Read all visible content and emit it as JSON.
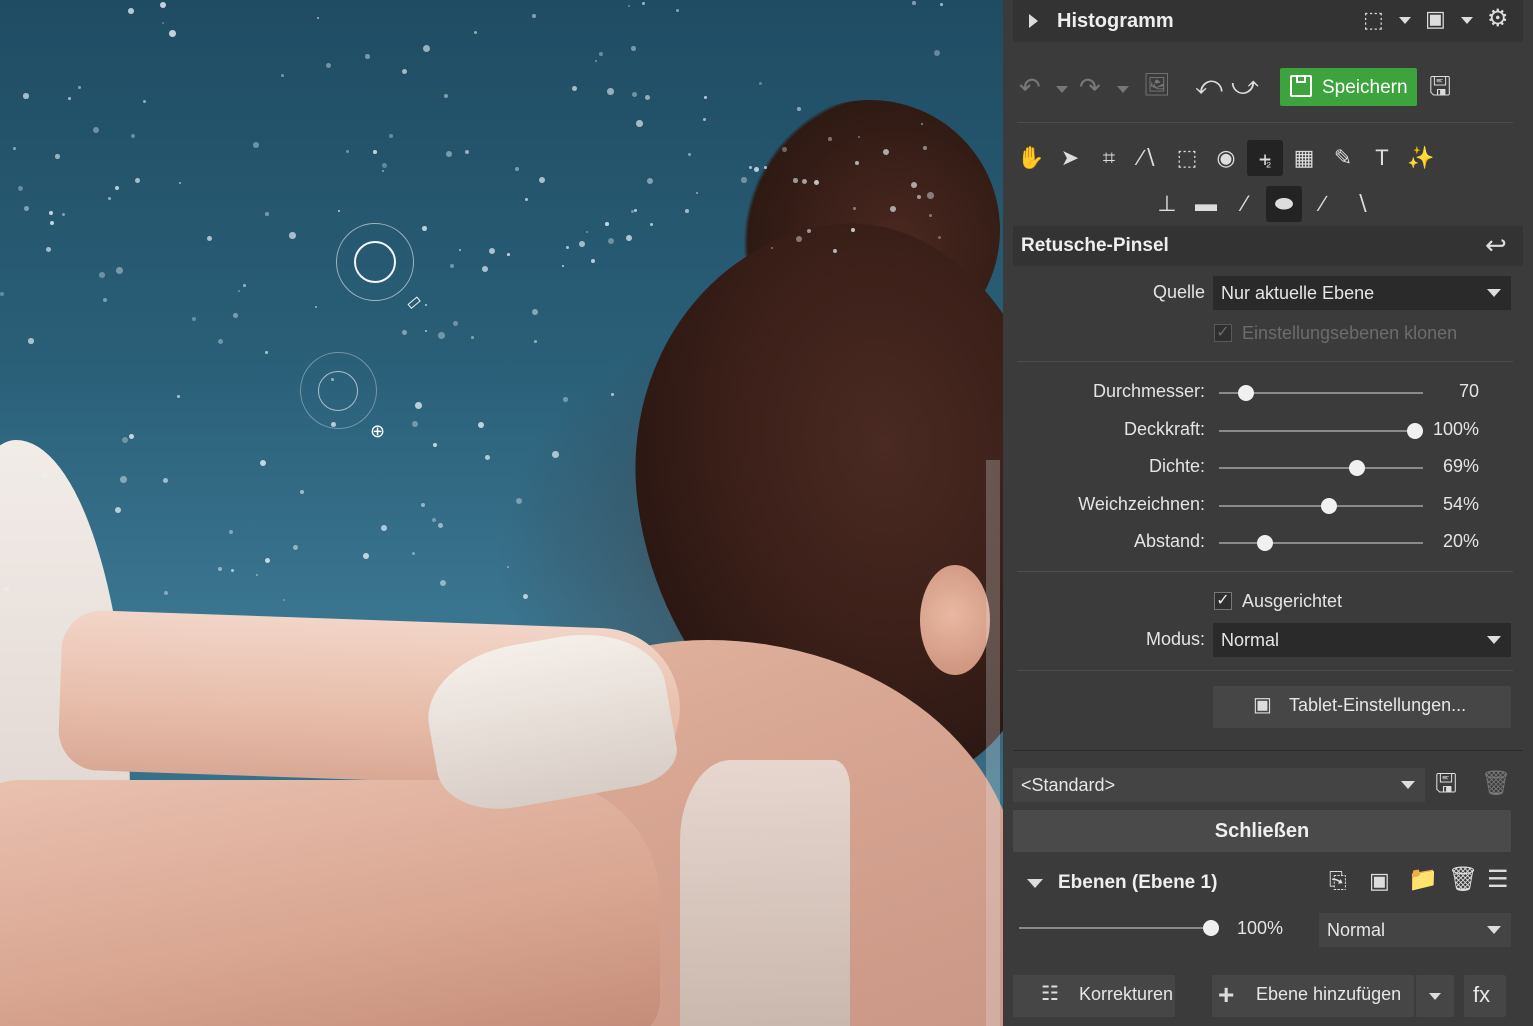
{
  "header": {
    "title": "Histogramm"
  },
  "toolbar": {
    "save_label": "Speichern"
  },
  "tool_section": {
    "title": "Retusche-Pinsel"
  },
  "source": {
    "label": "Quelle",
    "value": "Nur aktuelle Ebene",
    "clone_adjustments_label": "Einstellungsebenen klonen",
    "clone_adjustments_checked": true,
    "clone_adjustments_enabled": false
  },
  "sliders": [
    {
      "label": "Durchmesser:",
      "value": "70",
      "fraction": 0.1
    },
    {
      "label": "Deckkraft:",
      "value": "100%",
      "fraction": 1.0
    },
    {
      "label": "Dichte:",
      "value": "69%",
      "fraction": 0.69
    },
    {
      "label": "Weichzeichnen:",
      "value": "54%",
      "fraction": 0.54
    },
    {
      "label": "Abstand:",
      "value": "20%",
      "fraction": 0.2
    }
  ],
  "aligned": {
    "label": "Ausgerichtet",
    "checked": true
  },
  "mode": {
    "label": "Modus:",
    "value": "Normal"
  },
  "tablet_button": {
    "label": "Tablet-Einstellungen..."
  },
  "preset": {
    "value": "<Standard>"
  },
  "close_button": {
    "label": "Schließen"
  },
  "layers": {
    "title": "Ebenen (Ebene 1)",
    "opacity": "100%",
    "opacity_fraction": 1.0,
    "blend_mode": "Normal"
  },
  "bottom": {
    "corrections_label": "Korrekturen",
    "add_layer_label": "Ebene hinzufügen",
    "fx_label": "fx"
  },
  "icons": [
    "expand-triangle-icon",
    "crop-frame-icon",
    "mask-icon",
    "settings-gear-icon",
    "undo-icon",
    "redo-icon",
    "image-icon",
    "rotate-left-icon",
    "rotate-right-icon",
    "save-icon",
    "hand-icon",
    "pointer-icon",
    "crop-icon",
    "straighten-icon",
    "perspective-icon",
    "eye-icon",
    "clone-stamp-icon",
    "distortion-icon",
    "healing-icon",
    "text-icon",
    "sparkle-icon",
    "stamp-icon",
    "eraser-icon",
    "wand-icon",
    "bandage-icon",
    "smudge-icon",
    "dodge-icon",
    "reset-arrow-icon",
    "trash-icon",
    "duplicate-icon",
    "folder-icon",
    "menu-icon",
    "adjustments-icon",
    "plus-icon"
  ]
}
